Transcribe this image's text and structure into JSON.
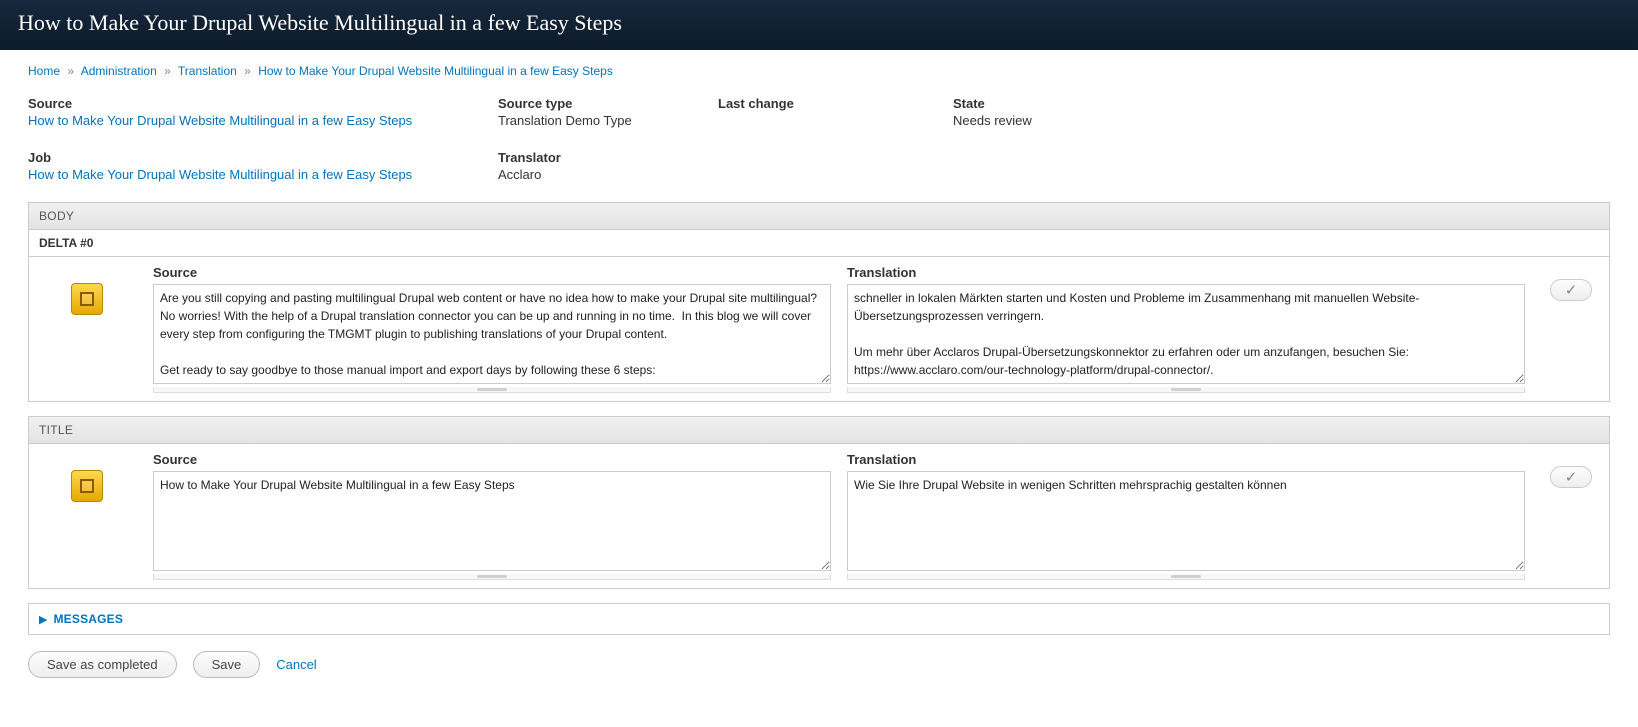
{
  "page_title": "How to Make Your Drupal Website Multilingual in a few Easy Steps",
  "breadcrumb": {
    "items": [
      "Home",
      "Administration",
      "Translation",
      "How to Make Your Drupal Website Multilingual in a few Easy Steps"
    ],
    "sep": "»"
  },
  "meta": {
    "source_label": "Source",
    "source_value": "How to Make Your Drupal Website Multilingual in a few Easy Steps",
    "source_type_label": "Source type",
    "source_type_value": "Translation Demo Type",
    "last_change_label": "Last change",
    "last_change_value": "",
    "state_label": "State",
    "state_value": "Needs review",
    "job_label": "Job",
    "job_value": "How to Make Your Drupal Website Multilingual in a few Easy Steps",
    "translator_label": "Translator",
    "translator_value": "Acclaro"
  },
  "body_section": {
    "header": "BODY",
    "delta_header": "DELTA #0",
    "source_label": "Source",
    "translation_label": "Translation",
    "source_text": "Are you still copying and pasting multilingual Drupal web content or have no idea how to make your Drupal site multilingual? No worries! With the help of a Drupal translation connector you can be up and running in no time.  In this blog we will cover every step from configuring the TMGMT plugin to publishing translations of your Drupal content.\n\nGet ready to say goodbye to those manual import and export days by following these 6 steps:",
    "translation_text": "schneller in lokalen Märkten starten und Kosten und Probleme im Zusammenhang mit manuellen Website-Übersetzungsprozessen verringern.\n\nUm mehr über Acclaros Drupal-Übersetzungskonnektor zu erfahren oder um anzufangen, besuchen Sie: https://www.acclaro.com/our-technology-platform/drupal-connector/."
  },
  "title_section": {
    "header": "TITLE",
    "source_label": "Source",
    "translation_label": "Translation",
    "source_text": "How to Make Your Drupal Website Multilingual in a few Easy Steps",
    "translation_text": "Wie Sie Ihre Drupal Website in wenigen Schritten mehrsprachig gestalten können"
  },
  "messages": {
    "label": "MESSAGES"
  },
  "actions": {
    "save_completed": "Save as completed",
    "save": "Save",
    "cancel": "Cancel"
  },
  "icons": {
    "check": "✓",
    "triangle": "▶"
  }
}
